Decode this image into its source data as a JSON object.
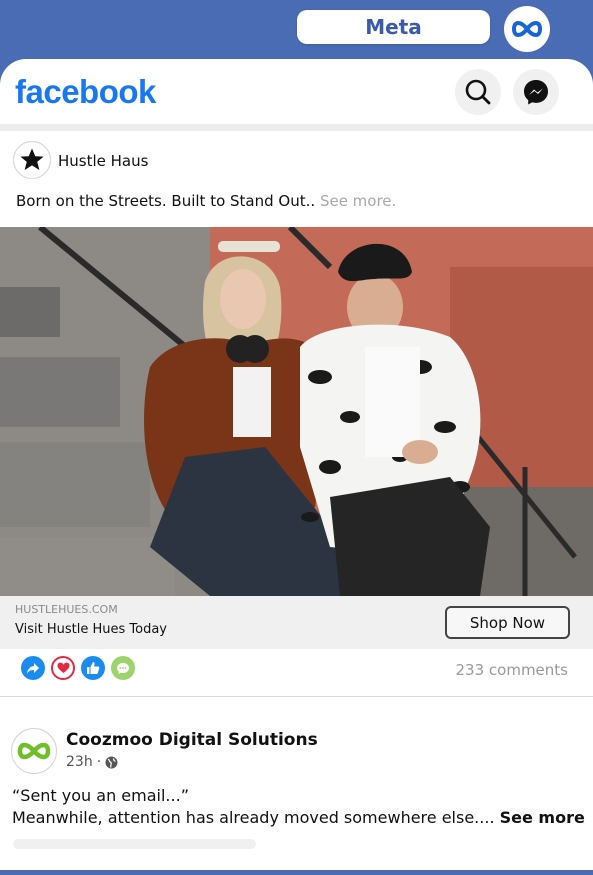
{
  "meta_bar": {
    "label": "Meta",
    "logo_icon": "meta-infinity-icon"
  },
  "header": {
    "logo_text": "facebook",
    "icons": [
      "search-icon",
      "messenger-icon"
    ],
    "colors": {
      "brand": "#1877f2",
      "meta_blue": "#4a6cb5"
    }
  },
  "post1": {
    "page_name": "Hustle Haus",
    "avatar_icon": "star-icon",
    "caption": "Born on the Streets. Built to Stand Out..",
    "see_more": "See more",
    "image_icon": "fashion-photo",
    "link": {
      "domain": "HUSTLEHUES.COM",
      "title": "Visit Hustle Hues Today",
      "cta": "Shop Now"
    },
    "reactions": [
      "share-icon",
      "love-icon",
      "like-icon",
      "comment-icon"
    ],
    "comments": "233 comments"
  },
  "post2": {
    "page_name": "Coozmoo Digital Solutions",
    "avatar_icon": "coozmoo-logo-icon",
    "time": "23h",
    "privacy_icon": "globe-icon",
    "caption_line1": "“Sent you an email...”",
    "caption_line2": "Meanwhile, attention has already moved somewhere else....",
    "see_more": "See more"
  }
}
